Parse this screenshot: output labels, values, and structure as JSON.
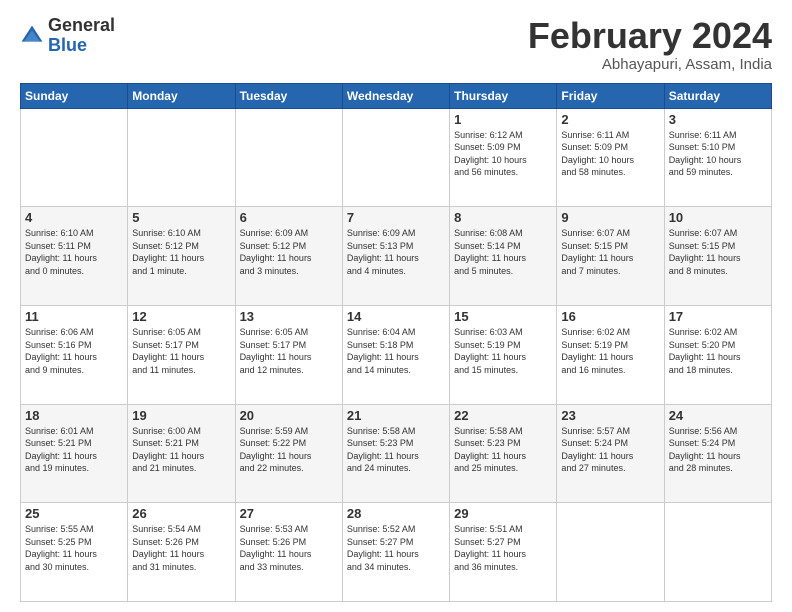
{
  "logo": {
    "general": "General",
    "blue": "Blue"
  },
  "header": {
    "title": "February 2024",
    "subtitle": "Abhayapuri, Assam, India"
  },
  "columns": [
    "Sunday",
    "Monday",
    "Tuesday",
    "Wednesday",
    "Thursday",
    "Friday",
    "Saturday"
  ],
  "weeks": [
    [
      {
        "day": "",
        "info": ""
      },
      {
        "day": "",
        "info": ""
      },
      {
        "day": "",
        "info": ""
      },
      {
        "day": "",
        "info": ""
      },
      {
        "day": "1",
        "info": "Sunrise: 6:12 AM\nSunset: 5:09 PM\nDaylight: 10 hours\nand 56 minutes."
      },
      {
        "day": "2",
        "info": "Sunrise: 6:11 AM\nSunset: 5:09 PM\nDaylight: 10 hours\nand 58 minutes."
      },
      {
        "day": "3",
        "info": "Sunrise: 6:11 AM\nSunset: 5:10 PM\nDaylight: 10 hours\nand 59 minutes."
      }
    ],
    [
      {
        "day": "4",
        "info": "Sunrise: 6:10 AM\nSunset: 5:11 PM\nDaylight: 11 hours\nand 0 minutes."
      },
      {
        "day": "5",
        "info": "Sunrise: 6:10 AM\nSunset: 5:12 PM\nDaylight: 11 hours\nand 1 minute."
      },
      {
        "day": "6",
        "info": "Sunrise: 6:09 AM\nSunset: 5:12 PM\nDaylight: 11 hours\nand 3 minutes."
      },
      {
        "day": "7",
        "info": "Sunrise: 6:09 AM\nSunset: 5:13 PM\nDaylight: 11 hours\nand 4 minutes."
      },
      {
        "day": "8",
        "info": "Sunrise: 6:08 AM\nSunset: 5:14 PM\nDaylight: 11 hours\nand 5 minutes."
      },
      {
        "day": "9",
        "info": "Sunrise: 6:07 AM\nSunset: 5:15 PM\nDaylight: 11 hours\nand 7 minutes."
      },
      {
        "day": "10",
        "info": "Sunrise: 6:07 AM\nSunset: 5:15 PM\nDaylight: 11 hours\nand 8 minutes."
      }
    ],
    [
      {
        "day": "11",
        "info": "Sunrise: 6:06 AM\nSunset: 5:16 PM\nDaylight: 11 hours\nand 9 minutes."
      },
      {
        "day": "12",
        "info": "Sunrise: 6:05 AM\nSunset: 5:17 PM\nDaylight: 11 hours\nand 11 minutes."
      },
      {
        "day": "13",
        "info": "Sunrise: 6:05 AM\nSunset: 5:17 PM\nDaylight: 11 hours\nand 12 minutes."
      },
      {
        "day": "14",
        "info": "Sunrise: 6:04 AM\nSunset: 5:18 PM\nDaylight: 11 hours\nand 14 minutes."
      },
      {
        "day": "15",
        "info": "Sunrise: 6:03 AM\nSunset: 5:19 PM\nDaylight: 11 hours\nand 15 minutes."
      },
      {
        "day": "16",
        "info": "Sunrise: 6:02 AM\nSunset: 5:19 PM\nDaylight: 11 hours\nand 16 minutes."
      },
      {
        "day": "17",
        "info": "Sunrise: 6:02 AM\nSunset: 5:20 PM\nDaylight: 11 hours\nand 18 minutes."
      }
    ],
    [
      {
        "day": "18",
        "info": "Sunrise: 6:01 AM\nSunset: 5:21 PM\nDaylight: 11 hours\nand 19 minutes."
      },
      {
        "day": "19",
        "info": "Sunrise: 6:00 AM\nSunset: 5:21 PM\nDaylight: 11 hours\nand 21 minutes."
      },
      {
        "day": "20",
        "info": "Sunrise: 5:59 AM\nSunset: 5:22 PM\nDaylight: 11 hours\nand 22 minutes."
      },
      {
        "day": "21",
        "info": "Sunrise: 5:58 AM\nSunset: 5:23 PM\nDaylight: 11 hours\nand 24 minutes."
      },
      {
        "day": "22",
        "info": "Sunrise: 5:58 AM\nSunset: 5:23 PM\nDaylight: 11 hours\nand 25 minutes."
      },
      {
        "day": "23",
        "info": "Sunrise: 5:57 AM\nSunset: 5:24 PM\nDaylight: 11 hours\nand 27 minutes."
      },
      {
        "day": "24",
        "info": "Sunrise: 5:56 AM\nSunset: 5:24 PM\nDaylight: 11 hours\nand 28 minutes."
      }
    ],
    [
      {
        "day": "25",
        "info": "Sunrise: 5:55 AM\nSunset: 5:25 PM\nDaylight: 11 hours\nand 30 minutes."
      },
      {
        "day": "26",
        "info": "Sunrise: 5:54 AM\nSunset: 5:26 PM\nDaylight: 11 hours\nand 31 minutes."
      },
      {
        "day": "27",
        "info": "Sunrise: 5:53 AM\nSunset: 5:26 PM\nDaylight: 11 hours\nand 33 minutes."
      },
      {
        "day": "28",
        "info": "Sunrise: 5:52 AM\nSunset: 5:27 PM\nDaylight: 11 hours\nand 34 minutes."
      },
      {
        "day": "29",
        "info": "Sunrise: 5:51 AM\nSunset: 5:27 PM\nDaylight: 11 hours\nand 36 minutes."
      },
      {
        "day": "",
        "info": ""
      },
      {
        "day": "",
        "info": ""
      }
    ]
  ]
}
